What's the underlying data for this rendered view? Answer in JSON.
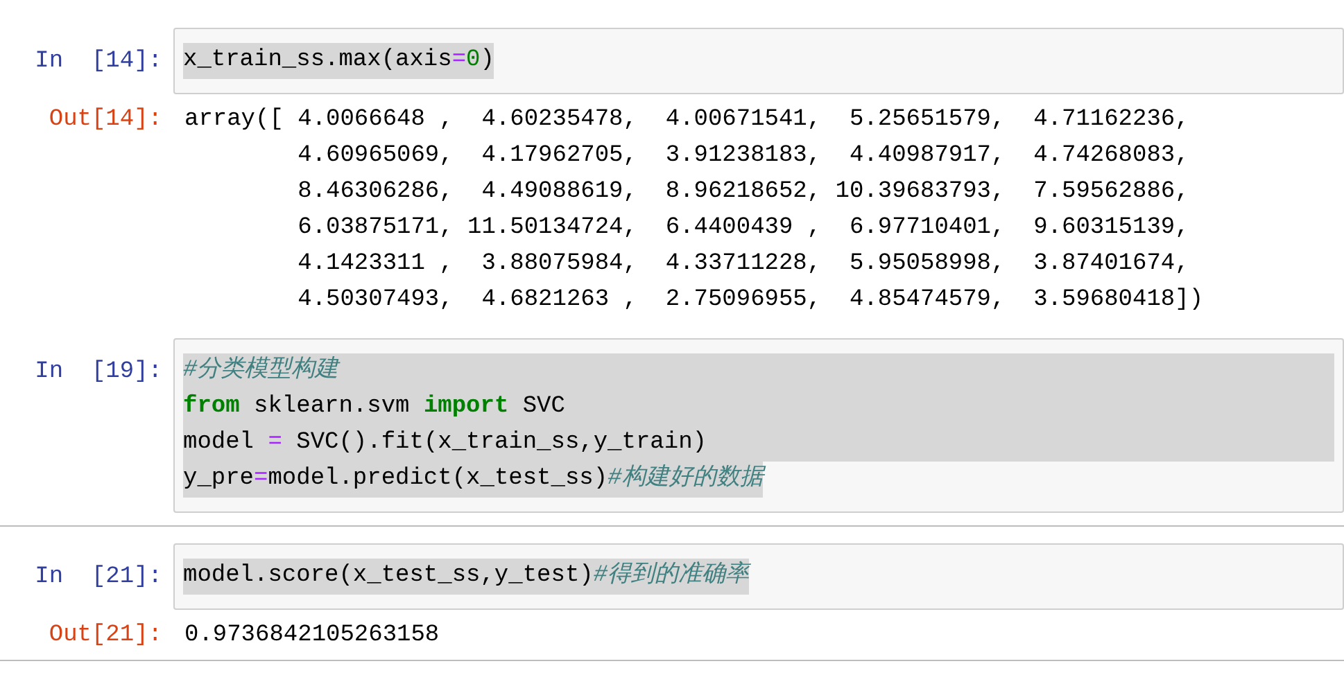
{
  "cells": [
    {
      "selected": false,
      "prompt": "In  [14]:",
      "input": [
        {
          "highlighted": true,
          "full_width": false,
          "tokens": [
            {
              "kind": "plain",
              "text": "x_train_ss.max(axis"
            },
            {
              "kind": "op",
              "text": "="
            },
            {
              "kind": "num",
              "text": "0"
            },
            {
              "kind": "plain",
              "text": ")"
            }
          ]
        }
      ],
      "output": {
        "prompt": "Out[14]:",
        "lines": [
          "array([ 4.0066648 ,  4.60235478,  4.00671541,  5.25651579,  4.71162236,",
          "        4.60965069,  4.17962705,  3.91238183,  4.40987917,  4.74268083,",
          "        8.46306286,  4.49088619,  8.96218652, 10.39683793,  7.59562886,",
          "        6.03875171, 11.50134724,  6.4400439 ,  6.97710401,  9.60315139,",
          "        4.1423311 ,  3.88075984,  4.33711228,  5.95058998,  3.87401674,",
          "        4.50307493,  4.6821263 ,  2.75096955,  4.85474579,  3.59680418])"
        ]
      }
    },
    {
      "selected": false,
      "prompt": "In  [19]:",
      "input": [
        {
          "highlighted": true,
          "full_width": true,
          "tokens": [
            {
              "kind": "comment",
              "text": "#分类模型构建"
            }
          ]
        },
        {
          "highlighted": true,
          "full_width": true,
          "tokens": [
            {
              "kind": "kw",
              "text": "from"
            },
            {
              "kind": "plain",
              "text": " sklearn.svm "
            },
            {
              "kind": "kw",
              "text": "import"
            },
            {
              "kind": "plain",
              "text": " SVC"
            }
          ]
        },
        {
          "highlighted": true,
          "full_width": true,
          "tokens": [
            {
              "kind": "plain",
              "text": "model "
            },
            {
              "kind": "op",
              "text": "="
            },
            {
              "kind": "plain",
              "text": " SVC().fit(x_train_ss,y_train)"
            }
          ]
        },
        {
          "highlighted": true,
          "full_width": false,
          "tokens": [
            {
              "kind": "plain",
              "text": "y_pre"
            },
            {
              "kind": "op",
              "text": "="
            },
            {
              "kind": "plain",
              "text": "model.predict(x_test_ss)"
            },
            {
              "kind": "comment",
              "text": "#构建好的数据"
            }
          ]
        }
      ]
    },
    {
      "selected": true,
      "prompt": "In  [21]:",
      "input": [
        {
          "highlighted": true,
          "full_width": false,
          "tokens": [
            {
              "kind": "plain",
              "text": "model.score(x_test_ss,y_test)"
            },
            {
              "kind": "comment",
              "text": "#得到的准确率"
            }
          ]
        }
      ],
      "output": {
        "prompt": "Out[21]:",
        "lines": [
          "0.9736842105263158"
        ]
      }
    }
  ]
}
